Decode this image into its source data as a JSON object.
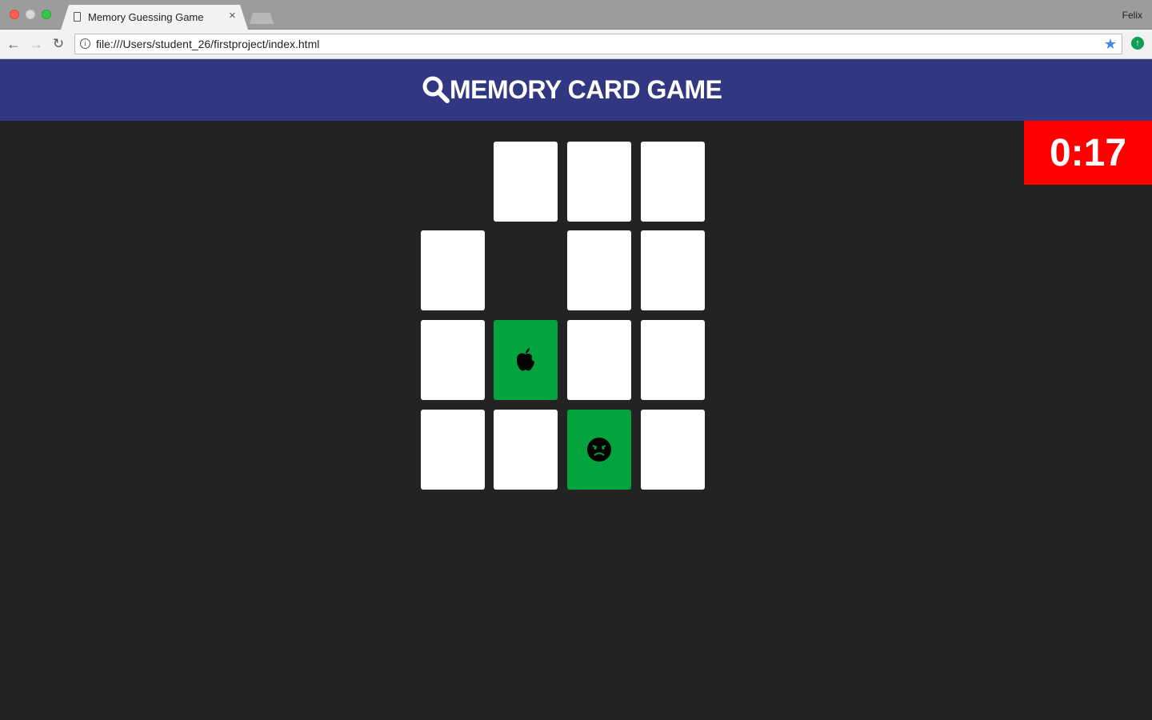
{
  "browser": {
    "tab_title": "Memory Guessing Game",
    "tab_close": "×",
    "profile_name": "Felix",
    "url": "file:///Users/student_26/firstproject/index.html",
    "back_glyph": "←",
    "forward_glyph": "→",
    "reload_glyph": "↻",
    "info_glyph": "i",
    "star_glyph": "★",
    "ext_glyph": "↑"
  },
  "game": {
    "title": "MEMORY CARD GAME",
    "title_icon": "magnifier-icon",
    "timer": "0:17",
    "timer_color": "#ff0000",
    "header_color": "#323781",
    "card_color": "#ffffff",
    "matched_color": "#03a33d",
    "grid": [
      [
        {
          "state": "removed"
        },
        {
          "state": "face-down"
        },
        {
          "state": "face-down"
        },
        {
          "state": "face-down"
        }
      ],
      [
        {
          "state": "face-down"
        },
        {
          "state": "removed"
        },
        {
          "state": "face-down"
        },
        {
          "state": "face-down"
        }
      ],
      [
        {
          "state": "face-down"
        },
        {
          "state": "face-up",
          "icon": "apple-icon"
        },
        {
          "state": "face-down"
        },
        {
          "state": "face-down"
        }
      ],
      [
        {
          "state": "face-down"
        },
        {
          "state": "face-down"
        },
        {
          "state": "face-up",
          "icon": "angry-face-icon"
        },
        {
          "state": "face-down"
        }
      ]
    ]
  }
}
